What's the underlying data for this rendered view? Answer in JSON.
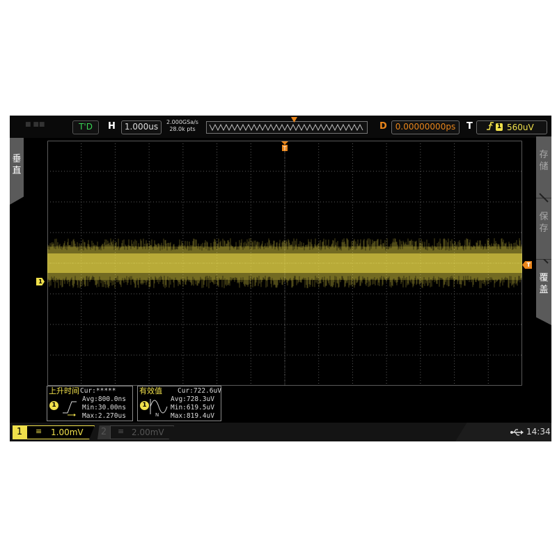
{
  "top_bar": {
    "trigger_status": "T'D",
    "timebase_label": "H",
    "timebase_value": "1.000us",
    "sample_rate": "2.000GSa/s",
    "memory_depth": "28.0k pts",
    "delay_label": "D",
    "delay_value": "0.00000000ps",
    "trigger_label": "T",
    "trigger_source": "1",
    "trigger_level": "560uV"
  },
  "left_tab": {
    "label": "垂直"
  },
  "right_menu": {
    "items": [
      {
        "label": "存储",
        "active": false
      },
      {
        "label": "保存",
        "active": false
      },
      {
        "label": "覆盖",
        "active": true
      }
    ]
  },
  "markers": {
    "channel1": "1",
    "trigger_level": "T",
    "trigger_position": "T"
  },
  "measurements": {
    "rise_time": {
      "title": "上升时间",
      "channel": "1",
      "cur": "Cur:*****",
      "avg": "Avg:800.0ns",
      "min": "Min:30.00ns",
      "max": "Max:2.270us"
    },
    "rms": {
      "title": "有效值",
      "channel": "1",
      "cur": "Cur:722.6uV",
      "avg": "Avg:728.3uV",
      "min": "Min:619.5uV",
      "max": "Max:819.4uV"
    }
  },
  "bottom_bar": {
    "ch1_number": "1",
    "ch1_coupling": "≡",
    "ch1_scale": "1.00mV",
    "ch2_number": "2",
    "ch2_coupling": "≡",
    "ch2_scale": "2.00mV",
    "time": "14:34"
  },
  "colors": {
    "channel1": "#f0e04b",
    "trigger": "#e8851b",
    "trigger_status": "#39d353",
    "grid": "#5a5a5a",
    "background": "#000000"
  }
}
